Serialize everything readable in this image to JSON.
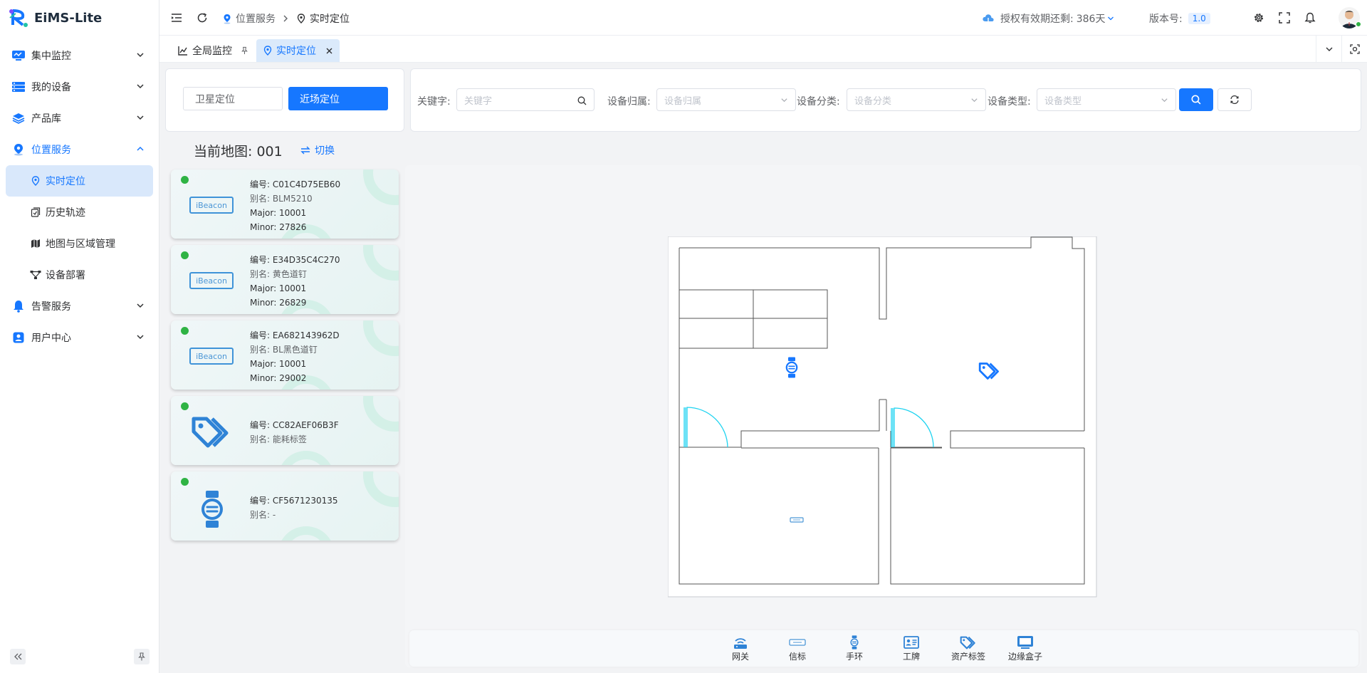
{
  "app": {
    "name": "EiMS-Lite"
  },
  "sidebar": {
    "items": [
      {
        "label": "集中监控"
      },
      {
        "label": "我的设备"
      },
      {
        "label": "产品库"
      },
      {
        "label": "位置服务",
        "children": [
          {
            "label": "实时定位"
          },
          {
            "label": "历史轨迹"
          },
          {
            "label": "地图与区域管理"
          },
          {
            "label": "设备部署"
          }
        ]
      },
      {
        "label": "告警服务"
      },
      {
        "label": "用户中心"
      }
    ]
  },
  "header": {
    "breadcrumb": [
      "位置服务",
      "实时定位"
    ],
    "license_label": "授权有效期还剩:",
    "license_value": "386天",
    "version_label": "版本号:",
    "version_value": "1.0"
  },
  "tabs": [
    {
      "label": "全局监控"
    },
    {
      "label": "实时定位"
    }
  ],
  "mode": {
    "satellite": "卫星定位",
    "nearfield": "近场定位"
  },
  "filters": [
    {
      "label": "关键字:",
      "placeholder": "关键字"
    },
    {
      "label": "设备归属:",
      "placeholder": "设备归属"
    },
    {
      "label": "设备分类:",
      "placeholder": "设备分类"
    },
    {
      "label": "设备类型:",
      "placeholder": "设备类型"
    }
  ],
  "map": {
    "title": "当前地图: 001",
    "switch_label": "切换"
  },
  "devices": [
    {
      "badge": "iBeacon",
      "icon": "ibeacon-icon",
      "lines": [
        "编号: C01C4D75EB60",
        "别名: BLM5210",
        "Major: 10001",
        "Minor: 27826"
      ]
    },
    {
      "badge": "iBeacon",
      "icon": "ibeacon-icon",
      "lines": [
        "编号: E34D35C4C270",
        "别名: 黄色道钉",
        "Major: 10001",
        "Minor: 26829"
      ]
    },
    {
      "badge": "iBeacon",
      "icon": "ibeacon-icon",
      "lines": [
        "编号: EA682143962D",
        "别名: BL黑色道钉",
        "Major: 10001",
        "Minor: 29002"
      ]
    },
    {
      "badge": "",
      "icon": "asset-tag-icon",
      "lines": [
        "编号: CC82AEF06B3F",
        "别名: 能耗标签"
      ]
    },
    {
      "badge": "",
      "icon": "wristband-icon",
      "lines": [
        "编号: CF5671230135",
        "别名: -"
      ]
    }
  ],
  "legend": [
    "网关",
    "信标",
    "手环",
    "工牌",
    "资产标签",
    "边缘盒子"
  ],
  "colors": {
    "accent": "#1677ff",
    "online": "#2fb344",
    "door": "#1ed3f0"
  }
}
